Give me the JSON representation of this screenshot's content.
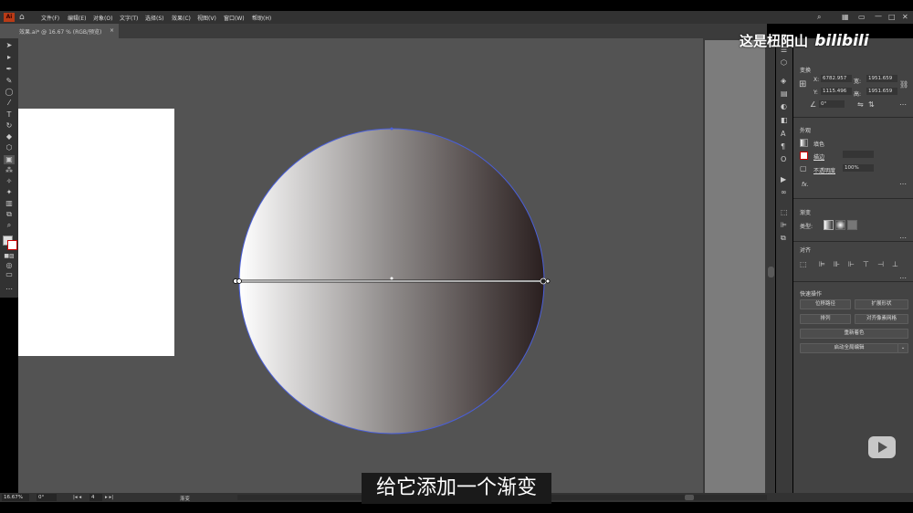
{
  "app_badge": "Ai",
  "menu": [
    "文件(F)",
    "编辑(E)",
    "对象(O)",
    "文字(T)",
    "选择(S)",
    "效果(C)",
    "视图(V)",
    "窗口(W)",
    "帮助(H)"
  ],
  "document_tab": "效果.ai* @ 16.67 % (RGB/预览)",
  "properties": {
    "transform_title": "变换",
    "x_label": "X:",
    "x_value": "6782.957",
    "y_label": "Y:",
    "y_value": "1115.496",
    "w_label": "宽:",
    "w_value": "1951.659",
    "h_label": "高:",
    "h_value": "1951.659",
    "angle_value": "0°",
    "appearance_title": "外观",
    "fill_label": "填色",
    "stroke_label": "描边",
    "opacity_label": "不透明度",
    "opacity_value": "100%",
    "fx_label": "fx.",
    "gradient_title": "渐变",
    "type_label": "类型:",
    "align_title": "对齐",
    "quick_actions_title": "快速操作",
    "btn_offset_path": "位移路径",
    "btn_expand_shape": "扩展形状",
    "btn_arrange": "排列",
    "btn_align_pixel": "对齐像素网格",
    "btn_recolor": "重新着色",
    "btn_global_edit": "启动全局编辑"
  },
  "status": {
    "zoom": "16.67%",
    "rotation": "0°",
    "artboard": "4",
    "tool": "渐变"
  },
  "subtitle": "给它添加一个渐变",
  "watermark": "这是杻阳山",
  "watermark_logo": "bilibili",
  "colors": {
    "gradient_start": "#ffffff",
    "gradient_end": "#2a1f1f",
    "selection": "#4a5fd9"
  }
}
